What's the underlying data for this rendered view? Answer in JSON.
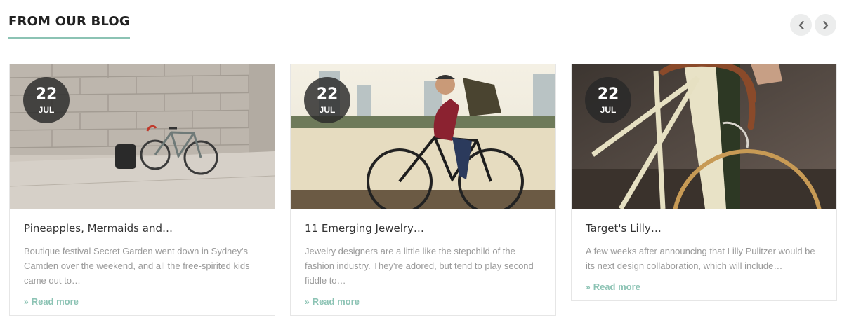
{
  "section": {
    "title": "FROM OUR BLOG"
  },
  "nav": {
    "prev_icon": "chevron-left-icon",
    "next_icon": "chevron-right-icon"
  },
  "colors": {
    "accent": "#8cc3b4",
    "date_badge": "#2b2b2b",
    "text_muted": "#999999"
  },
  "posts": [
    {
      "day": "22",
      "month": "JUL",
      "title": "Pineapples, Mermaids and…",
      "excerpt": "Boutique festival Secret Garden went down in Sydney's Camden over the weekend, and all the free-spirited kids came out to…",
      "readmore": "Read more"
    },
    {
      "day": "22",
      "month": "JUL",
      "title": "11 Emerging Jewelry…",
      "excerpt": "Jewelry designers are a little like the stepchild of the fashion industry. They're adored, but tend to play second fiddle to…",
      "readmore": "Read more"
    },
    {
      "day": "22",
      "month": "JUL",
      "title": "Target's Lilly…",
      "excerpt": "A few weeks after announcing that Lilly Pulitzer would be its next design collaboration, which will include…",
      "readmore": "Read more"
    }
  ]
}
